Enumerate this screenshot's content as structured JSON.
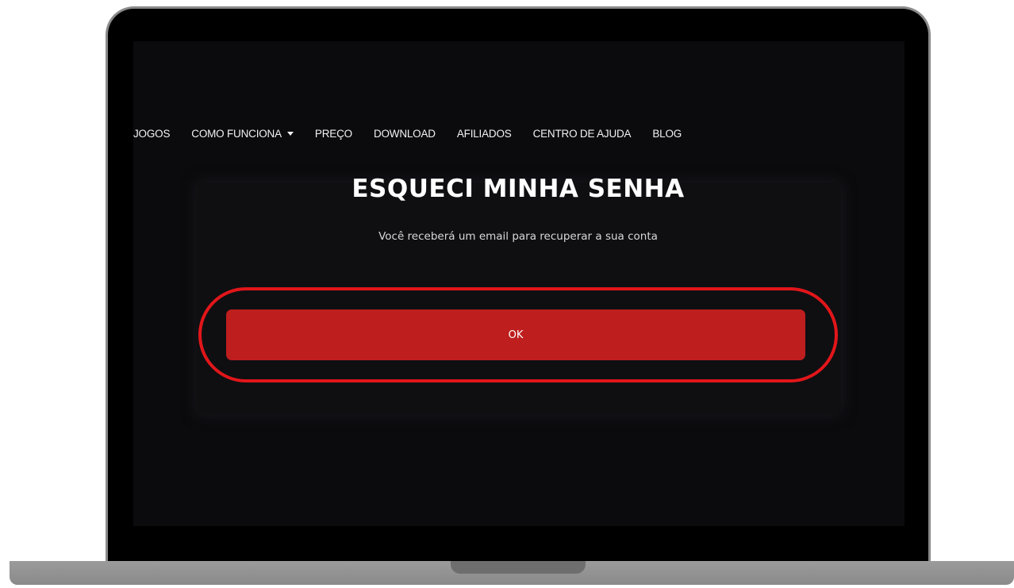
{
  "nav": {
    "items": [
      {
        "label": "JOGOS",
        "has_dropdown": false
      },
      {
        "label": "COMO FUNCIONA",
        "has_dropdown": true
      },
      {
        "label": "PREÇO",
        "has_dropdown": false
      },
      {
        "label": "DOWNLOAD",
        "has_dropdown": false
      },
      {
        "label": "AFILIADOS",
        "has_dropdown": false
      },
      {
        "label": "CENTRO DE AJUDA",
        "has_dropdown": false
      },
      {
        "label": "BLOG",
        "has_dropdown": false
      }
    ]
  },
  "dialog": {
    "title": "ESQUECI MINHA SENHA",
    "subtitle": "Você receberá um email para recuperar a sua conta",
    "ok_label": "OK"
  },
  "colors": {
    "accent": "#be1e1e",
    "highlight": "#e2161a",
    "background": "#0b0b0e",
    "card": "#0f0f12"
  }
}
